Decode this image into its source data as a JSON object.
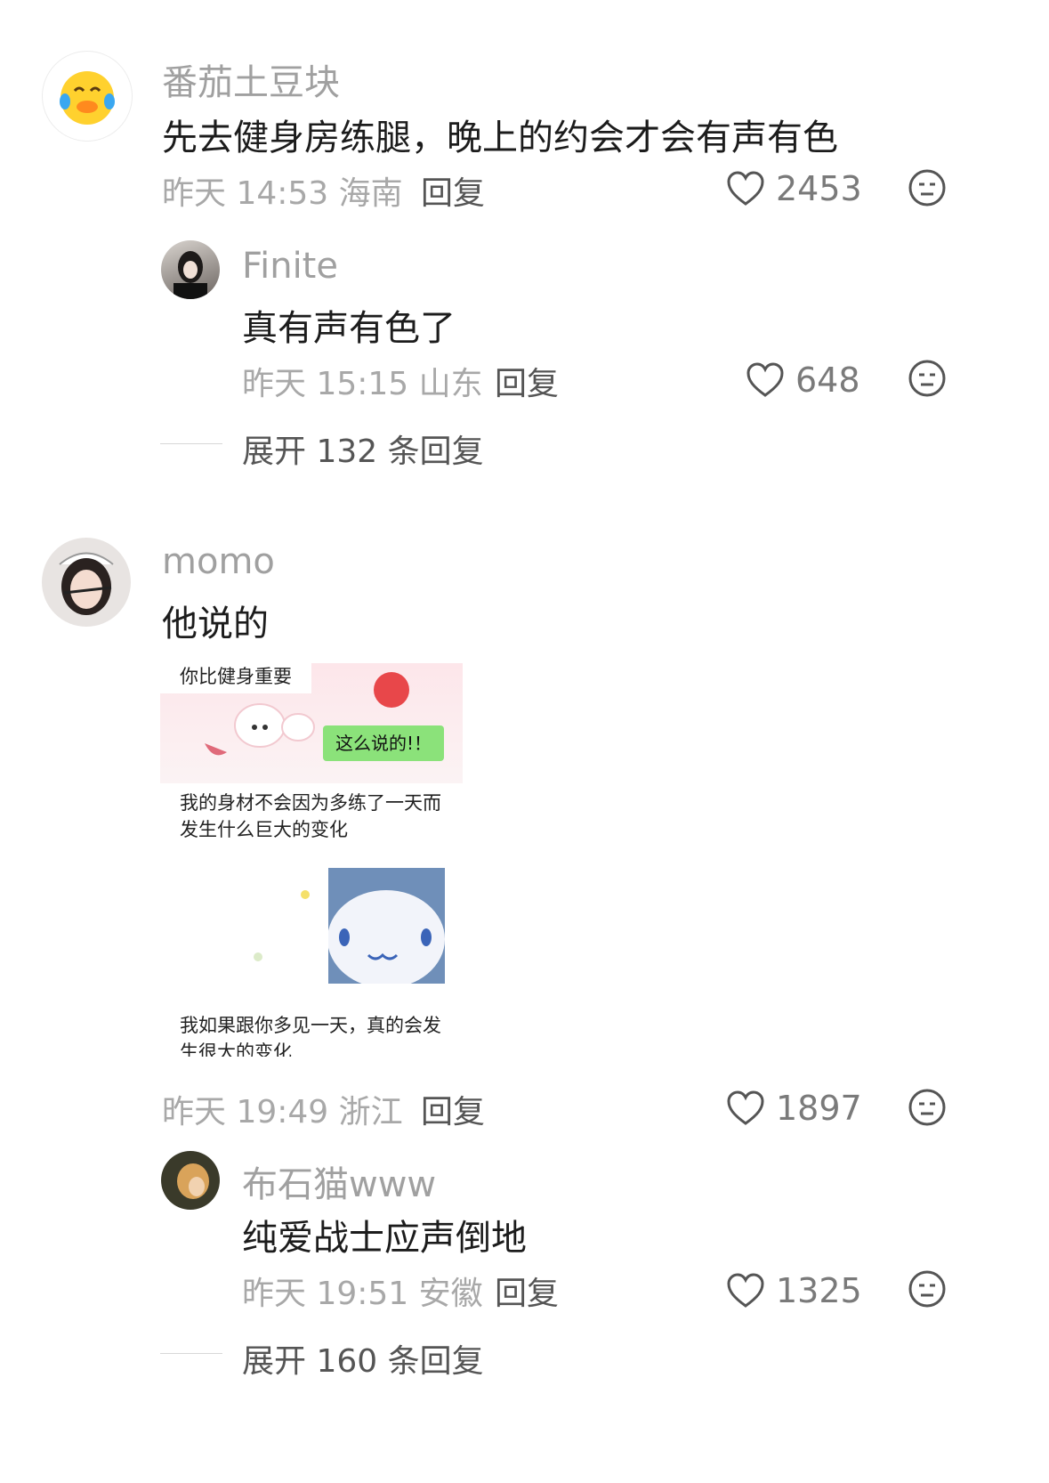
{
  "comments": [
    {
      "user": "番茄土豆块",
      "text": "先去健身房练腿，晚上的约会才会有声有色",
      "time": "昨天 14:53 海南",
      "reply_label": "回复",
      "likes": "2453",
      "reply": {
        "user": "Finite",
        "text": "真有声有色了",
        "time": "昨天 15:15 山东",
        "reply_label": "回复",
        "likes": "648"
      },
      "expand_label": "展开 132 条回复"
    },
    {
      "user": "momo",
      "text": "他说的",
      "sticker": {
        "top_caption": "你比健身重要",
        "bubble": "这么说的!！",
        "caption_1": "我的身材不会因为多练了一天而发生什么巨大的变化",
        "caption_2": "我如果跟你多见一天，真的会发生很大的变化"
      },
      "time": "昨天 19:49 浙江",
      "reply_label": "回复",
      "likes": "1897",
      "reply": {
        "user": "布石猫www",
        "text": "纯爱战士应声倒地",
        "time": "昨天 19:51 安徽",
        "reply_label": "回复",
        "likes": "1325"
      },
      "expand_label": "展开 160 条回复"
    }
  ],
  "colors": {
    "bubble_green": "#8be27a",
    "muted_text": "#a0a0a0",
    "main_text": "#1c1c1c"
  },
  "icons": [
    "heart-outline-icon",
    "meh-face-icon"
  ]
}
